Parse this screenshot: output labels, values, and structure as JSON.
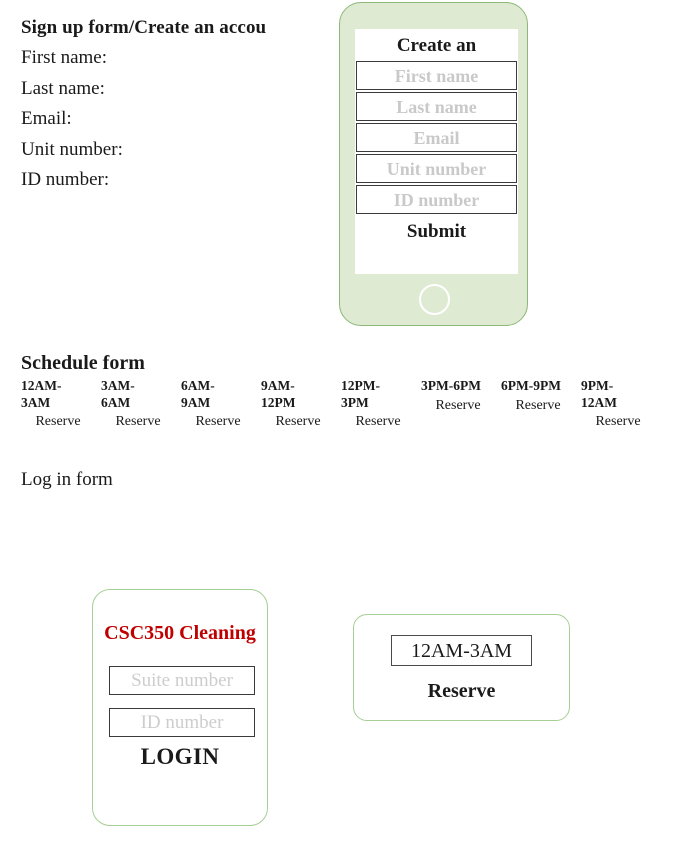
{
  "signup_section": {
    "title": "Sign up form/Create an accou",
    "fields": [
      "First name:",
      "Last name:",
      "Email:",
      "Unit number:",
      "ID number:"
    ]
  },
  "signup_phone": {
    "screen_title": "Create an",
    "placeholders": [
      "First name",
      "Last name",
      "Email",
      "Unit number",
      "ID number"
    ],
    "submit_label": "Submit",
    "home_button_icon": "circle-home-icon",
    "body_color": "#dfead2",
    "border_color": "#8cb878"
  },
  "schedule_section": {
    "title": "Schedule form",
    "reserve_label": "Reserve",
    "slots": [
      "12AM-3AM",
      "3AM-6AM",
      "6AM-9AM",
      "9AM-12PM",
      "12PM-3PM",
      "3PM-6PM",
      "6PM-9PM",
      "9PM-12AM"
    ]
  },
  "login_section": {
    "title": "Log in form"
  },
  "login_card": {
    "brand": "CSC350 Cleaning",
    "brand_color": "#c00000",
    "placeholders": [
      "Suite number",
      "ID number"
    ],
    "login_label": "LOGIN",
    "border_color": "#a6cf95"
  },
  "reserve_card": {
    "slot_label": "12AM-3AM",
    "action_label": "Reserve",
    "border_color": "#a6cf95"
  }
}
